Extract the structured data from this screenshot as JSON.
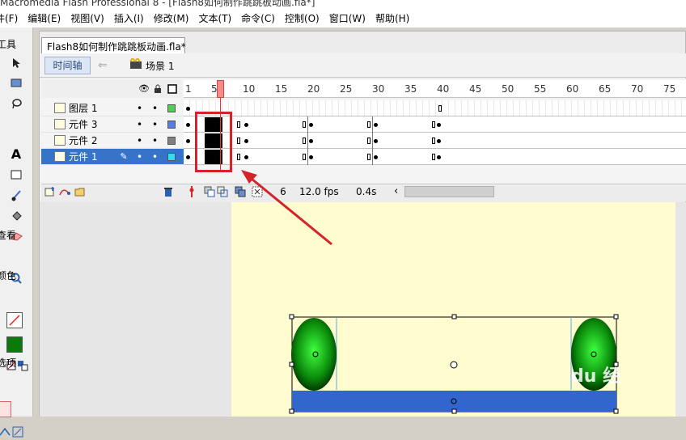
{
  "window": {
    "title": "Macromedia Flash Professional 8 - [Flash8如何制作跳跳板动画.fla*]"
  },
  "menu": [
    "件(F)",
    "编辑(E)",
    "视图(V)",
    "插入(I)",
    "修改(M)",
    "文本(T)",
    "命令(C)",
    "控制(O)",
    "窗口(W)",
    "帮助(H)"
  ],
  "tools": {
    "header_tools": "工具",
    "header_view": "查看",
    "header_colors": "颜色",
    "header_options": "选项"
  },
  "document": {
    "tab_title": "Flash8如何制作跳跳板动画.fla*",
    "timeline_button": "时间轴",
    "scene_label": "场景 1"
  },
  "timeline": {
    "ruler_ticks": [
      "1",
      "5",
      "10",
      "15",
      "20",
      "25",
      "30",
      "35",
      "40",
      "45",
      "50",
      "55",
      "60",
      "65",
      "70",
      "75"
    ],
    "current_frame": "6",
    "fps": "12.0 fps",
    "elapsed": "0.4s",
    "layers": [
      {
        "name": "图层 1",
        "color": "#55cc55",
        "selected": false
      },
      {
        "name": "元件 3",
        "color": "#5a7ee0",
        "selected": false
      },
      {
        "name": "元件 2",
        "color": "#808080",
        "selected": false
      },
      {
        "name": "元件 1",
        "color": "#3fd6e8",
        "selected": true
      }
    ]
  },
  "colors": {
    "annotation_red": "#d4242a",
    "selection_blue": "#3574c9",
    "stage_yellow": "#fffdd0",
    "board_blue": "#3366cc"
  },
  "watermark": {
    "text": "du 经"
  }
}
